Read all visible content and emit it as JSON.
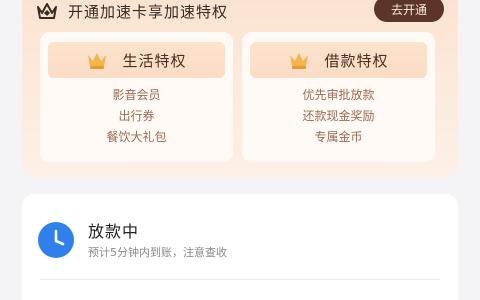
{
  "promo": {
    "title": "开通加速卡享加速特权",
    "open_button": "去开通",
    "icons": {
      "header": "crown-outline-icon",
      "panel": "crown-gold-icon"
    },
    "panels": [
      {
        "title": "生活特权",
        "items": [
          "影音会员",
          "出行券",
          "餐饮大礼包"
        ]
      },
      {
        "title": "借款特权",
        "items": [
          "优先审批放款",
          "还款现金奖励",
          "专属金币"
        ]
      }
    ]
  },
  "status": {
    "icon": "clock-icon",
    "title": "放款中",
    "subtitle": "预计5分钟内到账，注意查收"
  },
  "colors": {
    "promo_bg": "#fbe2cf",
    "button_bg": "#5a3528",
    "accent_blue": "#2f80ed",
    "benefit_text": "#a06a4f"
  }
}
